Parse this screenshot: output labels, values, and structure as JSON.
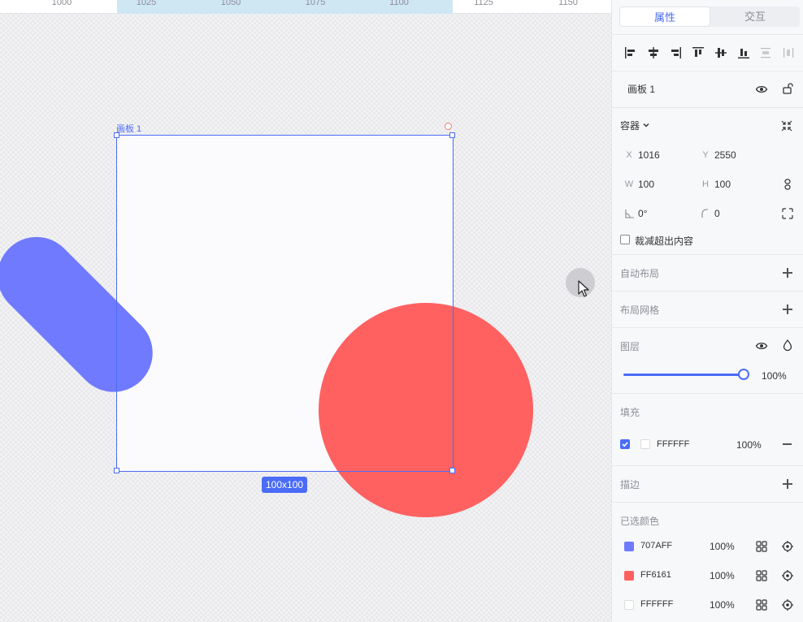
{
  "ruler": {
    "ticks": [
      "1000",
      "1025",
      "1050",
      "1075",
      "1100",
      "1125",
      "1150"
    ]
  },
  "canvas": {
    "artboard_label": "画板 1",
    "size_badge": "100x100"
  },
  "panel": {
    "tabs": [
      {
        "label": "属性",
        "active": true
      },
      {
        "label": "交互",
        "active": false
      }
    ],
    "layer_name": "画板 1",
    "container_label": "容器",
    "fields": {
      "x_label": "X",
      "x_value": "1016",
      "y_label": "Y",
      "y_value": "2550",
      "w_label": "W",
      "w_value": "100",
      "h_label": "H",
      "h_value": "100",
      "rotation_value": "0°",
      "radius_value": "0"
    },
    "clip_content_label": "裁减超出内容",
    "auto_layout_label": "自动布局",
    "layout_grid_label": "布局网格",
    "layer_section_label": "图层",
    "opacity_value": "100%",
    "opacity_level": 1.0,
    "fill_label": "填充",
    "fill": {
      "hex": "FFFFFF",
      "opacity": "100%"
    },
    "stroke_label": "描边",
    "selected_colors_label": "已选颜色",
    "selected_colors": [
      {
        "hex": "707AFF",
        "opacity": "100%",
        "color": "#707AFF"
      },
      {
        "hex": "FF6161",
        "opacity": "100%",
        "color": "#FF6161"
      },
      {
        "hex": "FFFFFF",
        "opacity": "100%",
        "color": "#FFFFFF"
      }
    ]
  },
  "colors": {
    "accent": "#4A6CF7",
    "pill": "#707AFF",
    "circle": "#FF6161"
  }
}
